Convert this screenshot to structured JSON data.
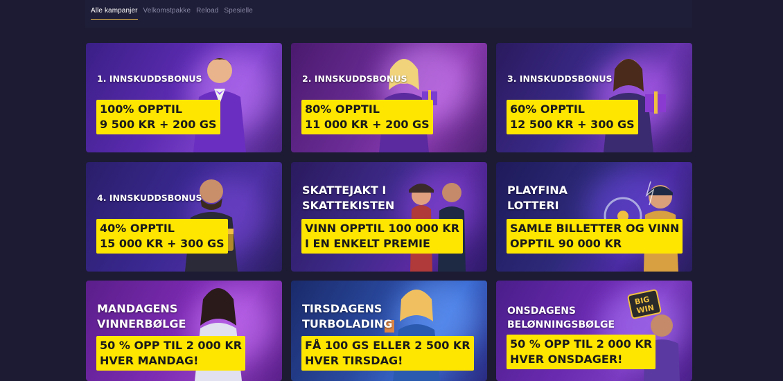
{
  "tabs": [
    {
      "label": "Alle kampanjer",
      "active": true
    },
    {
      "label": "Velkomstpakke",
      "active": false
    },
    {
      "label": "Reload",
      "active": false
    },
    {
      "label": "Spesielle",
      "active": false
    }
  ],
  "cards": [
    {
      "title": "1. INNSKUDDSBONUS",
      "offer_l1": "100% OPPTIL",
      "offer_l2": "9 500 KR + 200 GS"
    },
    {
      "title": "2. INNSKUDDSBONUS",
      "offer_l1": "80% OPPTIL",
      "offer_l2": "11 000 KR + 200 GS"
    },
    {
      "title": "3. INNSKUDDSBONUS",
      "offer_l1": "60% OPPTIL",
      "offer_l2": "12 500 KR + 300 GS"
    },
    {
      "title": "4. INNSKUDDSBONUS",
      "offer_l1": "40% OPPTIL",
      "offer_l2": "15 000 KR + 300 GS"
    },
    {
      "title_l1": "SKATTEJAKT I",
      "title_l2": "SKATTEKISTEN",
      "offer_l1": "VINN OPPTIL 100 000 KR",
      "offer_l2": "I EN ENKELT PREMIE"
    },
    {
      "title_l1": "PLAYFINA",
      "title_l2": "LOTTERI",
      "offer_l1": "SAMLE BILLETTER OG VINN",
      "offer_l2": "OPPTIL 90 000 KR"
    },
    {
      "title_l1": "MANDAGENS",
      "title_l2": "VINNERBØLGE",
      "offer_l1": "50 % OPP TIL 2 000 KR",
      "offer_l2": "HVER MANDAG!"
    },
    {
      "title_l1": "TIRSDAGENS",
      "title_l2": "TURBOLADING",
      "offer_l1": "FÅ 100 GS ELLER 2 500 KR",
      "offer_l2": "HVER TIRSDAG!"
    },
    {
      "title_l1": "ONSDAGENS",
      "title_l2": "BELØNNINGSBØLGE",
      "offer_l1": "50 % OPP TIL 2 000 KR",
      "offer_l2": "HVER ONSDAGER!"
    }
  ],
  "big_win_badge": {
    "l1": "BIG",
    "l2": "WIN"
  },
  "colors": {
    "background": "#1c1b33",
    "offer_yellow": "#ffe600",
    "tab_active_underline": "#e0b24a"
  }
}
